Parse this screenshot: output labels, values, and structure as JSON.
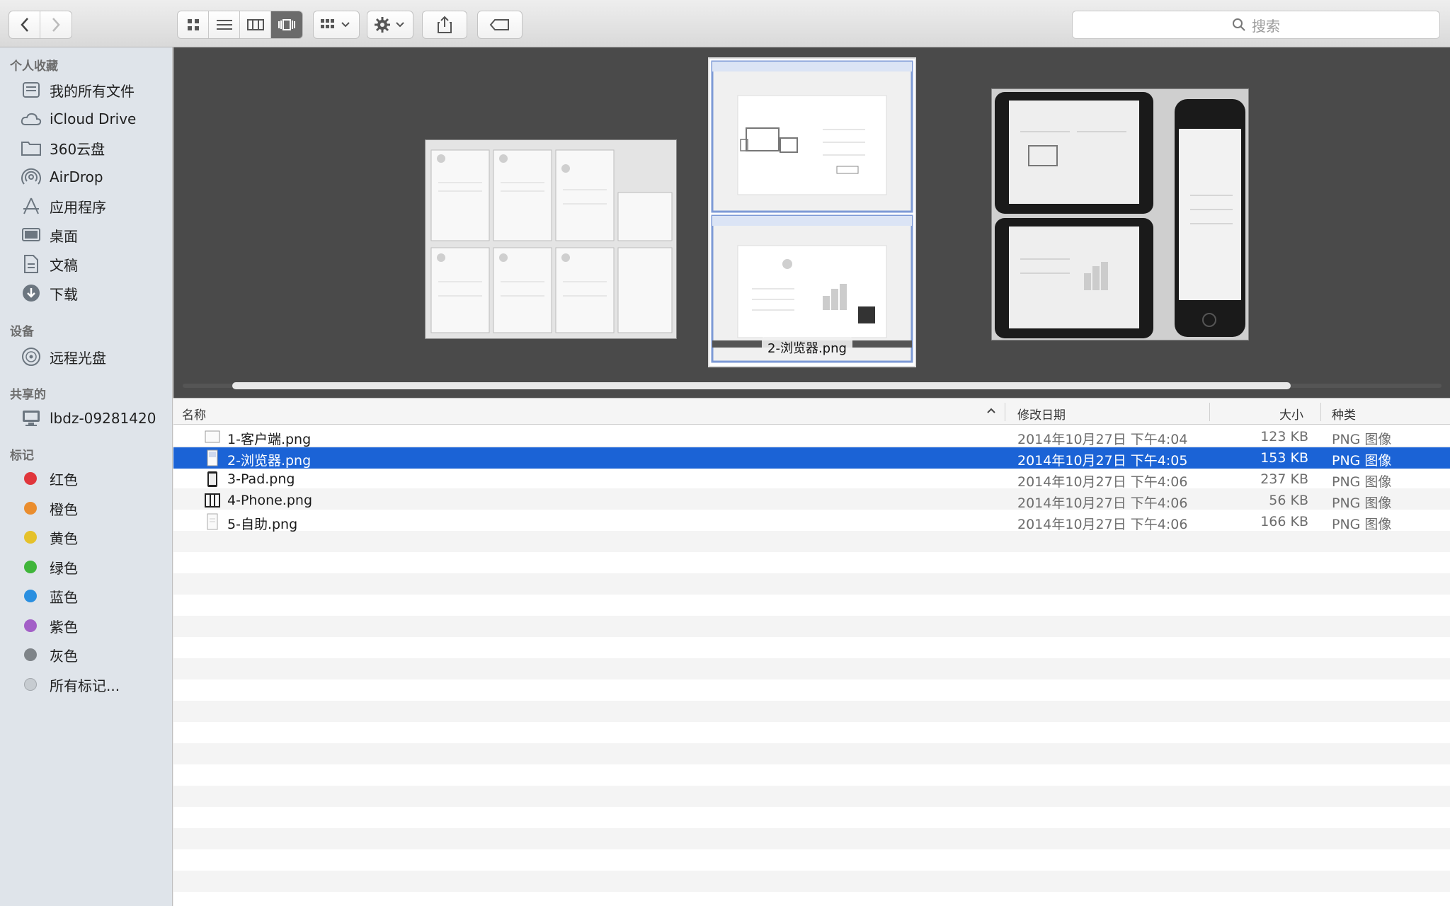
{
  "toolbar": {
    "back": "back",
    "forward": "forward",
    "search_placeholder": "搜索"
  },
  "sidebar": {
    "favorites_header": "个人收藏",
    "favorites": [
      "我的所有文件",
      "iCloud Drive",
      "360云盘",
      "AirDrop",
      "应用程序",
      "桌面",
      "文稿",
      "下载"
    ],
    "devices_header": "设备",
    "devices": [
      "远程光盘"
    ],
    "shared_header": "共享的",
    "shared": [
      "lbdz-09281420"
    ],
    "tags_header": "标记",
    "tags": [
      {
        "label": "红色",
        "color": "#e0363c"
      },
      {
        "label": "橙色",
        "color": "#ea8d2e"
      },
      {
        "label": "黄色",
        "color": "#e5c12b"
      },
      {
        "label": "绿色",
        "color": "#3fb53a"
      },
      {
        "label": "蓝色",
        "color": "#2a8fe0"
      },
      {
        "label": "紫色",
        "color": "#a35fc7"
      },
      {
        "label": "灰色",
        "color": "#7f8489"
      }
    ],
    "all_tags": "所有标记..."
  },
  "coverflow": {
    "caption": "2-浏览器.png"
  },
  "list": {
    "headers": {
      "name": "名称",
      "modified": "修改日期",
      "size": "大小",
      "kind": "种类"
    },
    "rows": [
      {
        "name": "1-客户端.png",
        "modified": "2014年10月27日 下午4:04",
        "size": "123 KB",
        "kind": "PNG 图像"
      },
      {
        "name": "2-浏览器.png",
        "modified": "2014年10月27日 下午4:05",
        "size": "153 KB",
        "kind": "PNG 图像"
      },
      {
        "name": "3-Pad.png",
        "modified": "2014年10月27日 下午4:06",
        "size": "237 KB",
        "kind": "PNG 图像"
      },
      {
        "name": "4-Phone.png",
        "modified": "2014年10月27日 下午4:06",
        "size": "56 KB",
        "kind": "PNG 图像"
      },
      {
        "name": "5-自助.png",
        "modified": "2014年10月27日 下午4:06",
        "size": "166 KB",
        "kind": "PNG 图像"
      }
    ],
    "selected_index": 1
  }
}
